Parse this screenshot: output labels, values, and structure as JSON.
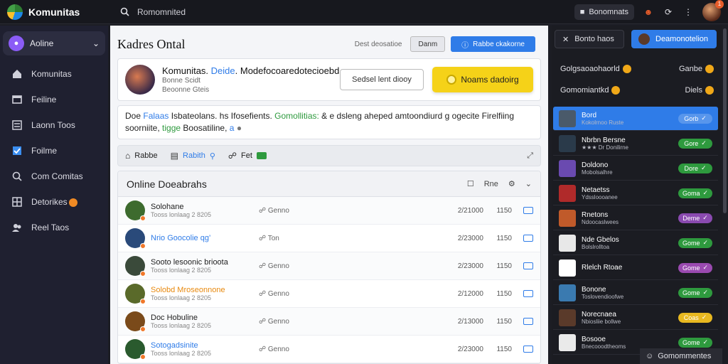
{
  "app": {
    "name": "Komunitas"
  },
  "topbar": {
    "search_placeholder": "Romomnited",
    "account_label": "Bonomnats",
    "notif_count": "1"
  },
  "sidebar": {
    "selector_label": "Aoline",
    "items": [
      {
        "label": "Komunitas",
        "icon": "home-icon"
      },
      {
        "label": "Feiline",
        "icon": "window-icon"
      },
      {
        "label": "Laonn Toos",
        "icon": "list-icon"
      },
      {
        "label": "Foilme",
        "icon": "checkbox-icon"
      },
      {
        "label": "Com Comitas",
        "icon": "chat-icon"
      },
      {
        "label": "Detorikes",
        "icon": "grid-icon"
      },
      {
        "label": "Reel Taos",
        "icon": "people-icon"
      }
    ]
  },
  "main": {
    "title": "Kadres Ontal",
    "head_link": "Dest deosatioe",
    "head_btn": "Danm",
    "head_primary": "Rabbe ckakorne",
    "profile": {
      "name_prefix": "Komunitas.",
      "name_highlight": "Deide",
      "name_rest": ". Modefocoaredotecioebd",
      "sub1": "Bonne Scidt",
      "sub2": "Beoonne Gteis"
    },
    "btn_outline": "Sedsel lent diooy",
    "btn_yellow": "Noams dadoirg",
    "desc": {
      "p1": "Doe ",
      "blue1": "Falaas",
      "p2": " Isbateolans. hs Ifosefients. ",
      "green1": "Gomollitias:",
      "p3": " & e dsleng aheped amtoondiurd g ogecite Firelfiing soorniite, ",
      "green2": "tigge",
      "p4": " Boosatiline, ",
      "blue2": "a"
    },
    "tabs": [
      {
        "label": "Rabbe",
        "icon": "home-icon"
      },
      {
        "label": "Rabith",
        "icon": "doc-icon"
      },
      {
        "label": "Fet",
        "icon": "link-icon"
      }
    ],
    "list": {
      "title": "Online Doeabrahs",
      "ctrl_label": "Rne",
      "rows": [
        {
          "name": "Solohane",
          "sub": "Tooss lonlaag 2 8205",
          "tag": "Genno",
          "date": "2/21000",
          "num": "1150",
          "color": "",
          "avatar": "#3d6b2e"
        },
        {
          "name": "Nrio Goocolie qg’",
          "sub": "",
          "tag": "Ton",
          "date": "2/23000",
          "num": "1150",
          "color": "blue",
          "avatar": "#2a4a7a"
        },
        {
          "name": "Sooto lesoonic brioota",
          "sub": "Tooss lonlaag 2 8205",
          "tag": "Genno",
          "date": "2/23000",
          "num": "1150",
          "color": "",
          "avatar": "#3a4a3a"
        },
        {
          "name": "Solobd Mroseonnone",
          "sub": "Tooss lonlaag 2 8205",
          "tag": "Genno",
          "date": "2/12000",
          "num": "1150",
          "color": "orange",
          "avatar": "#5a6a2a"
        },
        {
          "name": "Doc Hobuline",
          "sub": "Tooss lonlaag 2 8205",
          "tag": "Genno",
          "date": "2/13000",
          "num": "1150",
          "color": "",
          "avatar": "#7a4a1a"
        },
        {
          "name": "Sotogadsinite",
          "sub": "Tooss lonlaag 2 8205",
          "tag": "Genno",
          "date": "2/23000",
          "num": "1150",
          "color": "blue",
          "avatar": "#2a5a2e"
        }
      ]
    }
  },
  "right": {
    "btn_dark": "Bonto haos",
    "btn_blue": "Deamonotelion",
    "sections": [
      {
        "title": "Golgsaoaohaorld",
        "right": "Ganbe"
      },
      {
        "title": "Gomomiantkd",
        "right": "Diels"
      }
    ],
    "items": [
      {
        "name": "Bord",
        "sub": "Kokolrnoo Ruste",
        "pill": "Gorb",
        "pill_color": "#ffffff33",
        "thumb": "#4a5a6a",
        "selected": true
      },
      {
        "name": "Nbrbn Bersne",
        "sub": "★★★ Dr Donilirne",
        "pill": "Gore",
        "pill_color": "#2e9a3e",
        "thumb": "#2a3a4a",
        "selected": false
      },
      {
        "name": "Doldono",
        "sub": "Mobolsalhre",
        "pill": "Dore",
        "pill_color": "#2e9a3e",
        "thumb": "#6a4ab0",
        "selected": false
      },
      {
        "name": "Netaetss",
        "sub": "Ydssloooanee",
        "pill": "Goma",
        "pill_color": "#2e9a3e",
        "thumb": "#b02a2a",
        "selected": false
      },
      {
        "name": "Rnetons",
        "sub": "Ndoocaslwees",
        "pill": "Deme",
        "pill_color": "#8a4ab0",
        "thumb": "#c05a2a",
        "selected": false
      },
      {
        "name": "Nde Gbelos",
        "sub": "Bolslrolltoa",
        "pill": "Gome",
        "pill_color": "#2e9a3e",
        "thumb": "#e8e8e8",
        "selected": false
      },
      {
        "name": "Rlelch Rtoae",
        "sub": "",
        "pill": "Gome",
        "pill_color": "#9a4ab0",
        "thumb": "#ffffff",
        "selected": false
      },
      {
        "name": "Bonone",
        "sub": "Toslovendioofwe",
        "pill": "Gome",
        "pill_color": "#2e9a3e",
        "thumb": "#3a7ab0",
        "selected": false
      },
      {
        "name": "Norecnaea",
        "sub": "Nbiosliie bollwe",
        "pill": "Coas",
        "pill_color": "#e8b820",
        "thumb": "#5a3a2a",
        "selected": false
      },
      {
        "name": "Bosooe",
        "sub": "Bnecooodtheoms",
        "pill": "Gome",
        "pill_color": "#2e9a3e",
        "thumb": "#eaeaea",
        "selected": false
      }
    ],
    "footer_label": "Gomommentes"
  }
}
